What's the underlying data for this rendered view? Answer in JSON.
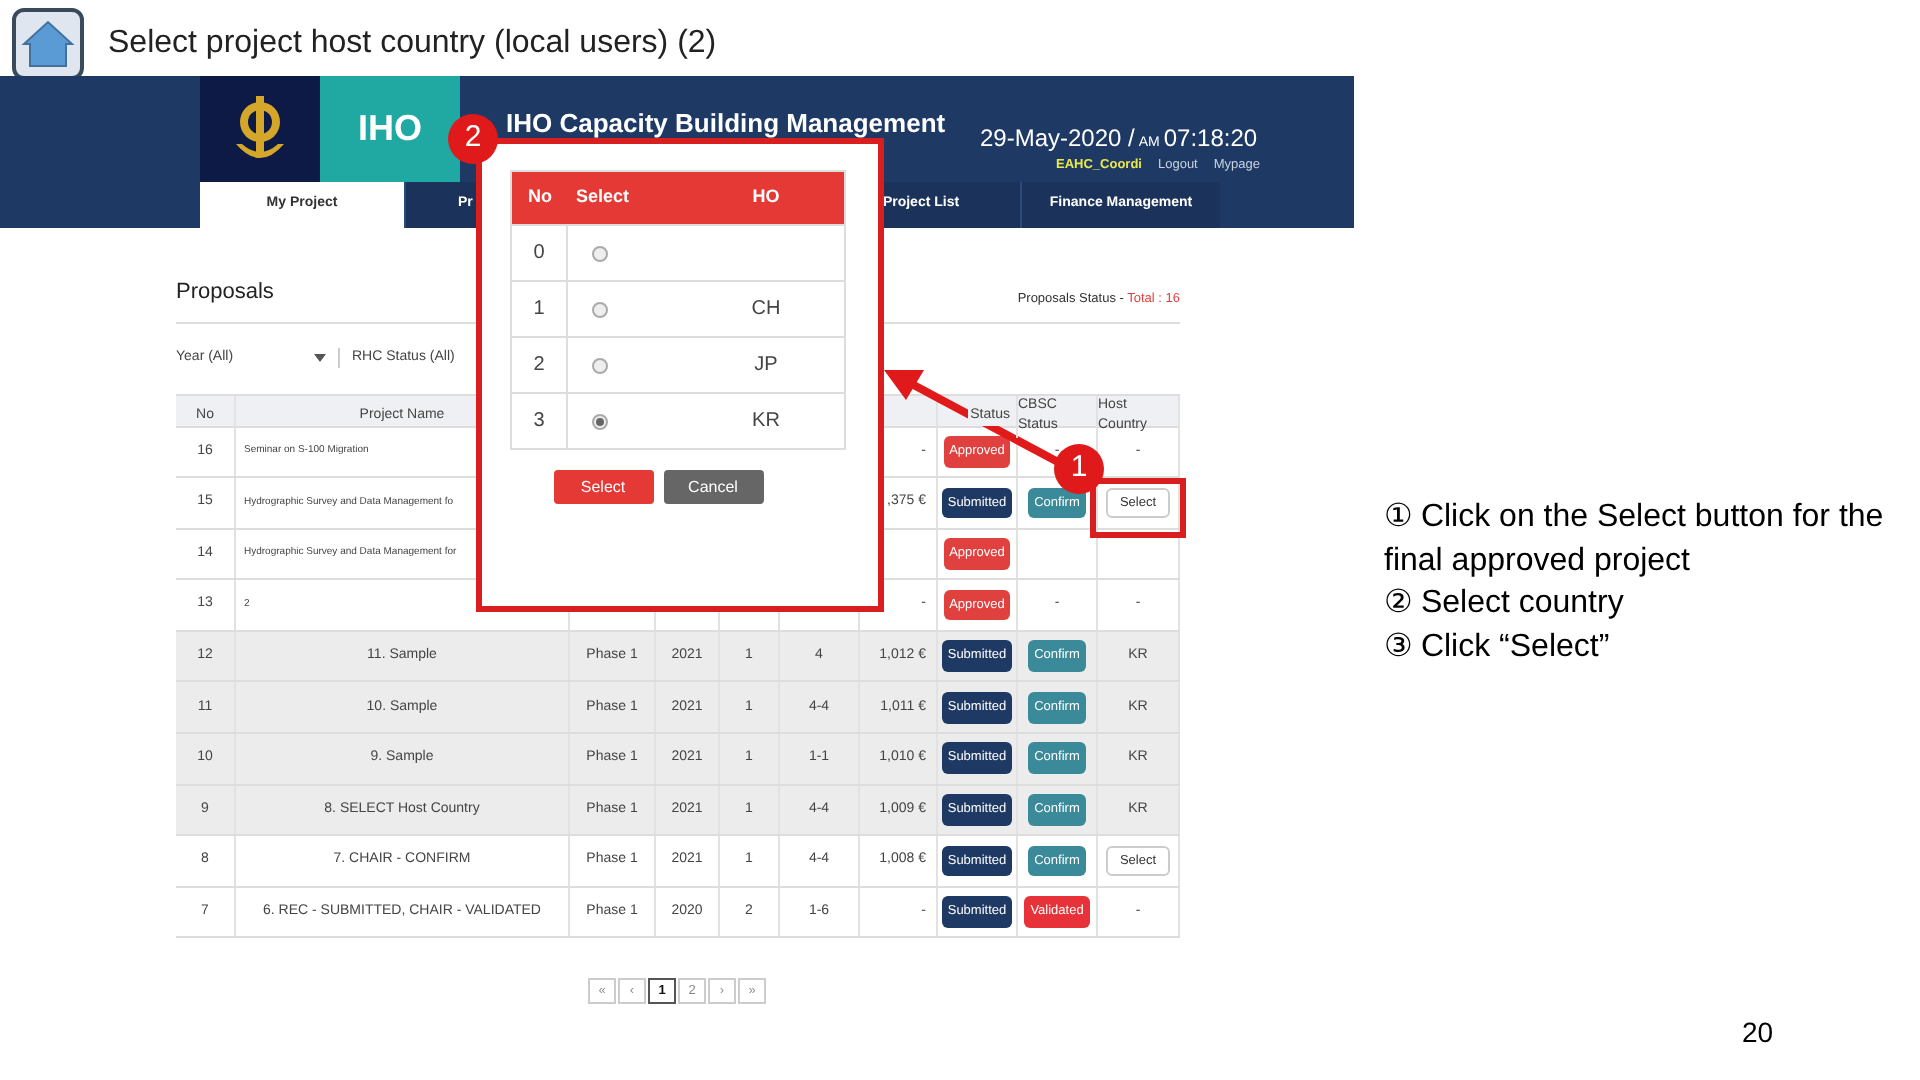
{
  "slide": {
    "title": "Select project host country (local users) (2)",
    "page_number": "20",
    "instructions": [
      "① Click on the Select button for the final approved project",
      "② Select country",
      "③ Click “Select”"
    ],
    "callouts": [
      {
        "label": "2"
      },
      {
        "label": "1"
      }
    ]
  },
  "header": {
    "logo_text": "IHO",
    "title": "IHO Capacity Building Management",
    "date": "29-May-2020 /",
    "ampm": "AM",
    "time": "07:18:20",
    "user": "EAHC_Coordi",
    "links": [
      "Logout",
      "Mypage"
    ]
  },
  "nav_tabs": [
    {
      "label": "My Project",
      "selected": true
    },
    {
      "label": "Pr",
      "selected": false
    },
    {
      "label": "Project List",
      "selected": false
    },
    {
      "label": "Finance Management",
      "selected": false
    }
  ],
  "proposals": {
    "title": "Proposals",
    "status_label": "Proposals Status - ",
    "total": "Total : 16",
    "filters": [
      "Year (All)",
      "RHC Status (All)"
    ],
    "columns": {
      "no": "No",
      "project_name": "Project Name",
      "rhc_status": "Status",
      "cbsc_status": "CBSC Status",
      "host_country": "Host Country"
    },
    "rows": [
      {
        "no": "16",
        "name": "Seminar on S-100 Migration",
        "budget": "-",
        "rhc": {
          "kind": "approved",
          "text": "Approved"
        },
        "cbsc": {
          "kind": "text",
          "text": "-"
        },
        "host": {
          "kind": "text",
          "text": "-"
        },
        "shaded": false
      },
      {
        "no": "15",
        "name": "Hydrographic Survey and Data Management fo",
        "budget": ",375 €",
        "rhc": {
          "kind": "submitted",
          "text": "Submitted"
        },
        "cbsc": {
          "kind": "confirm",
          "text": "Confirm"
        },
        "host": {
          "kind": "button",
          "text": "Select"
        },
        "shaded": false
      },
      {
        "no": "14",
        "name": "Hydrographic Survey and Data Management for",
        "rhc": {
          "kind": "approved",
          "text": "Approved"
        },
        "shaded": false
      },
      {
        "no": "13",
        "name": "2",
        "budget": "-",
        "rhc": {
          "kind": "approved",
          "text": "Approved"
        },
        "cbsc": {
          "kind": "text",
          "text": "-"
        },
        "host": {
          "kind": "text",
          "text": "-"
        },
        "shaded": false
      },
      {
        "no": "12",
        "name": "11. Sample",
        "phase": "Phase 1",
        "year": "2021",
        "column_5": "1",
        "column_6": "4",
        "budget": "1,012 €",
        "rhc": {
          "kind": "submitted",
          "text": "Submitted"
        },
        "cbsc": {
          "kind": "confirm",
          "text": "Confirm"
        },
        "host": {
          "kind": "text",
          "text": "KR"
        },
        "shaded": true
      },
      {
        "no": "11",
        "name": "10. Sample",
        "phase": "Phase 1",
        "year": "2021",
        "column_5": "1",
        "column_6": "4-4",
        "budget": "1,011 €",
        "rhc": {
          "kind": "submitted",
          "text": "Submitted"
        },
        "cbsc": {
          "kind": "confirm",
          "text": "Confirm"
        },
        "host": {
          "kind": "text",
          "text": "KR"
        },
        "shaded": true
      },
      {
        "no": "10",
        "name": "9. Sample",
        "phase": "Phase 1",
        "year": "2021",
        "column_5": "1",
        "column_6": "1-1",
        "budget": "1,010 €",
        "rhc": {
          "kind": "submitted",
          "text": "Submitted"
        },
        "cbsc": {
          "kind": "confirm",
          "text": "Confirm"
        },
        "host": {
          "kind": "text",
          "text": "KR"
        },
        "shaded": true
      },
      {
        "no": "9",
        "name": "8. SELECT Host Country",
        "phase": "Phase 1",
        "year": "2021",
        "column_5": "1",
        "column_6": "4-4",
        "budget": "1,009 €",
        "rhc": {
          "kind": "submitted",
          "text": "Submitted"
        },
        "cbsc": {
          "kind": "confirm",
          "text": "Confirm"
        },
        "host": {
          "kind": "text",
          "text": "KR"
        },
        "shaded": true
      },
      {
        "no": "8",
        "name": "7. CHAIR - CONFIRM",
        "phase": "Phase 1",
        "year": "2021",
        "column_5": "1",
        "column_6": "4-4",
        "budget": "1,008 €",
        "rhc": {
          "kind": "submitted",
          "text": "Submitted"
        },
        "cbsc": {
          "kind": "confirm",
          "text": "Confirm"
        },
        "host": {
          "kind": "button",
          "text": "Select"
        },
        "shaded": false
      },
      {
        "no": "7",
        "name": "6. REC - SUBMITTED, CHAIR - VALIDATED",
        "phase": "Phase 1",
        "year": "2020",
        "column_5": "2",
        "column_6": "1-6",
        "budget": "-",
        "rhc": {
          "kind": "submitted",
          "text": "Submitted"
        },
        "cbsc": {
          "kind": "validated",
          "text": "Validated"
        },
        "host": {
          "kind": "text",
          "text": "-"
        },
        "shaded": false
      }
    ],
    "pagination": [
      {
        "label": "«",
        "selected": false
      },
      {
        "label": "‹",
        "selected": false
      },
      {
        "label": "1",
        "selected": true
      },
      {
        "label": "2",
        "selected": false
      },
      {
        "label": "›",
        "selected": false
      },
      {
        "label": "»",
        "selected": false
      }
    ]
  },
  "dialog": {
    "columns": [
      "No",
      "Select",
      "HO"
    ],
    "rows": [
      {
        "no": "0",
        "selected": false
      },
      {
        "no": "1",
        "country": "CH",
        "selected": false
      },
      {
        "no": "2",
        "country": "JP",
        "selected": false
      },
      {
        "no": "3",
        "country": "KR",
        "selected": true
      }
    ],
    "buttons": [
      {
        "kind": "primary",
        "label": "Select"
      },
      {
        "kind": "secondary",
        "label": "Cancel"
      }
    ]
  }
}
